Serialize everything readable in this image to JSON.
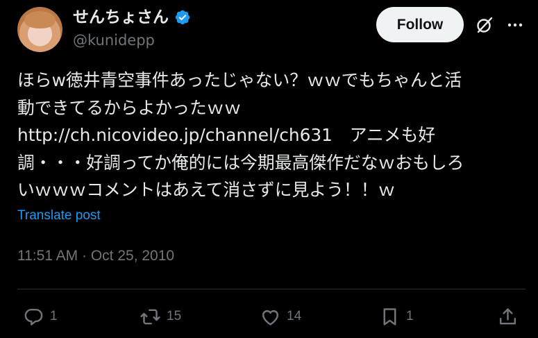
{
  "user": {
    "display_name": "せんちょさん",
    "handle": "@kunidepp"
  },
  "header": {
    "follow_label": "Follow"
  },
  "post": {
    "lines": [
      "ほらw徳井青空事件あったじゃない？ｗｗでもちゃんと活",
      "動できてるからよかったｗｗ",
      "http://ch.nicovideo.jp/channel/ch631　アニメも好",
      "調・・・好調ってか俺的には今期最高傑作だなｗおもしろ",
      "いｗｗｗコメントはあえて消さずに見よう！！ｗ"
    ],
    "translate_label": "Translate post",
    "timestamp": "11:51 AM · Oct 25, 2010"
  },
  "actions": {
    "replies": "1",
    "reposts": "15",
    "likes": "14",
    "bookmarks": "1"
  },
  "colors": {
    "background": "#000000",
    "text": "#e7e9ea",
    "muted": "#71767b",
    "link": "#1d9bf0",
    "verified": "#1d9bf0"
  }
}
